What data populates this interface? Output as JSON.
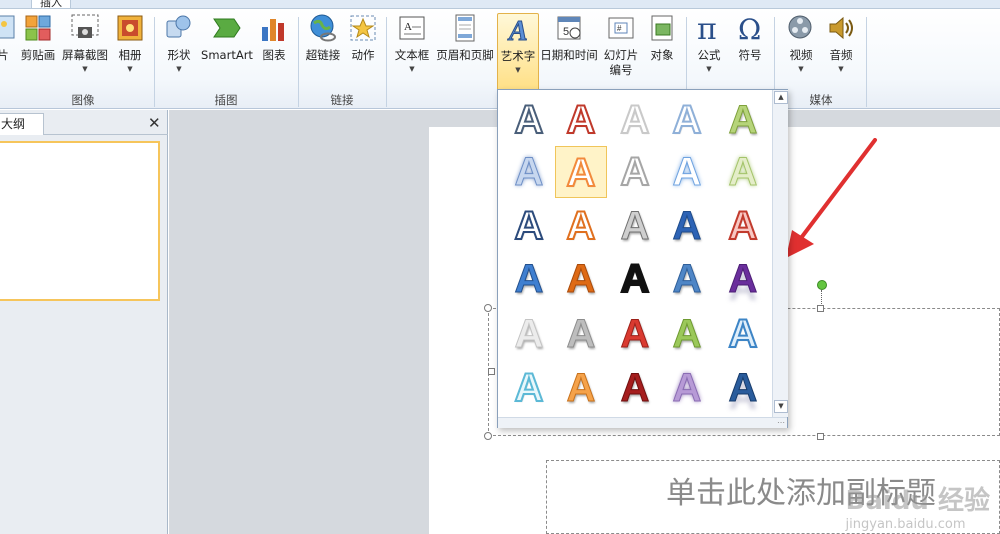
{
  "tabs": [
    "插入"
  ],
  "ribbon": {
    "buttons": [
      {
        "label": "片",
        "caret": false
      },
      {
        "label": "剪贴画",
        "caret": false
      },
      {
        "label": "屏幕截图",
        "caret": true
      },
      {
        "label": "相册",
        "caret": true
      },
      {
        "label": "形状",
        "caret": true
      },
      {
        "label": "SmartArt",
        "caret": false
      },
      {
        "label": "图表",
        "caret": false
      },
      {
        "label": "超链接",
        "caret": false
      },
      {
        "label": "动作",
        "caret": false
      },
      {
        "label": "文本框",
        "caret": true
      },
      {
        "label": "页眉和页脚",
        "caret": false
      },
      {
        "label": "艺术字",
        "caret": true
      },
      {
        "label": "日期和时间",
        "caret": false
      },
      {
        "label": "幻灯片\n编号",
        "caret": false
      },
      {
        "label": "对象",
        "caret": false
      },
      {
        "label": "公式",
        "caret": true
      },
      {
        "label": "符号",
        "caret": false
      },
      {
        "label": "视频",
        "caret": true
      },
      {
        "label": "音频",
        "caret": true
      }
    ],
    "groups": [
      "图像",
      "插图",
      "链接",
      "媒体"
    ]
  },
  "left_pane": {
    "tab_label": "大纲",
    "close": "✕"
  },
  "slide": {
    "subtitle_placeholder": "单击此处添加副标题",
    "watermark": "Baidu 经验",
    "watermark_url": "jingyan.baidu.com"
  },
  "wordart": {
    "glyph": "A",
    "styles": [
      {
        "fill": "#ffffff",
        "stroke": "#4a5f7a",
        "effect": "outline"
      },
      {
        "fill": "#ffffff",
        "stroke": "#c0392b",
        "effect": "outline"
      },
      {
        "fill": "#ffffff",
        "stroke": "#c9c9c9",
        "effect": "outline"
      },
      {
        "fill": "#ffffff",
        "stroke": "#8fb0d8",
        "effect": "outline"
      },
      {
        "fill": "#b6d47a",
        "stroke": "#7fa13c",
        "effect": "flat"
      },
      {
        "fill": "#c7d7ef",
        "stroke": "#6e8fc6",
        "effect": "glow"
      },
      {
        "fill": "#ffffff",
        "stroke": "#f28a3c",
        "effect": "outline"
      },
      {
        "fill": "#ffffff",
        "stroke": "#a6a6a6",
        "effect": "outline"
      },
      {
        "fill": "#ffffff",
        "stroke": "#6fa3e0",
        "effect": "glow"
      },
      {
        "fill": "#e4edc8",
        "stroke": "#a4c46a",
        "effect": "glow"
      },
      {
        "fill": "#ffffff",
        "stroke": "#2c4b7c",
        "effect": "outline"
      },
      {
        "fill": "#ffffff",
        "stroke": "#e07020",
        "effect": "outline"
      },
      {
        "fill": "#cfcfcf",
        "stroke": "#707070",
        "effect": "flat"
      },
      {
        "fill": "#2d63b5",
        "stroke": "#1e4b8a",
        "effect": "flat"
      },
      {
        "fill": "#f8c7c2",
        "stroke": "#c23b2e",
        "effect": "outline"
      },
      {
        "fill": "#3f7fd0",
        "stroke": "#23508d",
        "effect": "flat"
      },
      {
        "fill": "#de6a15",
        "stroke": "#a94b0b",
        "effect": "flat"
      },
      {
        "fill": "#111111",
        "stroke": "#111111",
        "effect": "outline"
      },
      {
        "fill": "#4f86c6",
        "stroke": "#2f5f9a",
        "effect": "flat"
      },
      {
        "fill": "#6a2e9c",
        "stroke": "#4c1e75",
        "effect": "reflect"
      },
      {
        "fill": "#ececec",
        "stroke": "#c4c4c4",
        "effect": "flat"
      },
      {
        "fill": "#bdbdbd",
        "stroke": "#8d8d8d",
        "effect": "flat"
      },
      {
        "fill": "#d93a30",
        "stroke": "#9c1f18",
        "effect": "flat"
      },
      {
        "fill": "#9bc85a",
        "stroke": "#6e9a30",
        "effect": "flat"
      },
      {
        "fill": "#dfeefa",
        "stroke": "#3d85c6",
        "effect": "outline"
      },
      {
        "fill": "#e9f7fb",
        "stroke": "#5cb9d6",
        "effect": "outline"
      },
      {
        "fill": "#f5a24a",
        "stroke": "#c7711c",
        "effect": "flat"
      },
      {
        "fill": "#a51d1d",
        "stroke": "#6f0f0f",
        "effect": "flat"
      },
      {
        "fill": "#b79ad6",
        "stroke": "#8a6cb3",
        "effect": "glow"
      },
      {
        "fill": "#2a5c9c",
        "stroke": "#173b6b",
        "effect": "reflect"
      }
    ]
  },
  "colors": {
    "accent_selected": "#ffdf84",
    "annotation_arrow": "#e03030",
    "rotation_handle": "#63c540"
  }
}
